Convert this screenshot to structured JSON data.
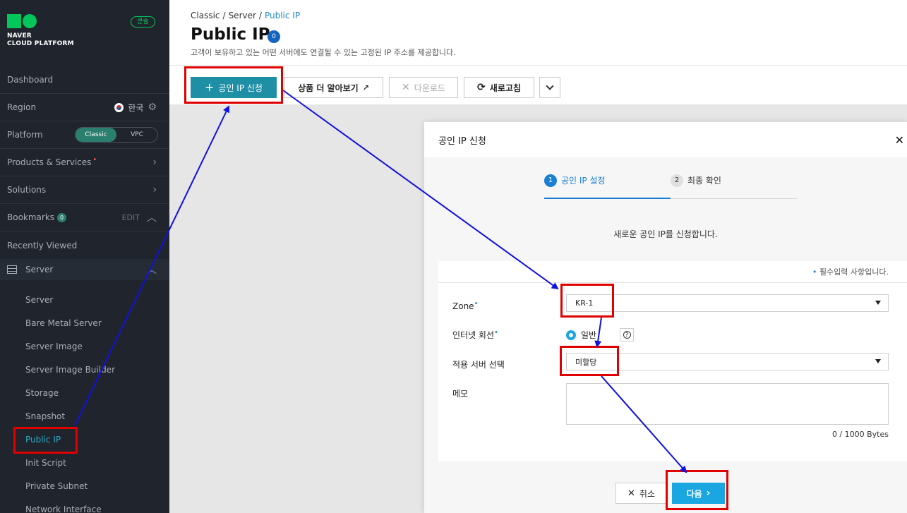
{
  "sidebar": {
    "logo_line1": "NAVER",
    "logo_line2": "CLOUD PLATFORM",
    "lang_badge": "쿤솔",
    "dashboard": "Dashboard",
    "region_label": "Region",
    "region_value": "한국",
    "platform_label": "Platform",
    "platform_classic": "Classic",
    "platform_vpc": "VPC",
    "products": "Products & Services",
    "products_marker": "•",
    "solutions": "Solutions",
    "bookmarks": "Bookmarks",
    "bookmarks_count": "0",
    "bookmarks_edit": "EDIT",
    "recently_viewed": "Recently Viewed",
    "server_group": "Server",
    "items": [
      "Server",
      "Bare Metal Server",
      "Server Image",
      "Server Image Builder",
      "Storage",
      "Snapshot",
      "Public IP",
      "Init Script",
      "Private Subnet",
      "Network Interface"
    ]
  },
  "breadcrumb": {
    "c1": "Classic",
    "sep": "/",
    "c2": "Server",
    "c3": "Public IP"
  },
  "page": {
    "title": "Public IP",
    "count": "0",
    "description": "고객이 보유하고 있는 어떤 서버에도 연결될 수 있는 고정된 IP 주소를 제공합니다."
  },
  "toolbar": {
    "apply": "공인 IP 신청",
    "learn_more": "상품 더 알아보기",
    "download": "다운로드",
    "refresh": "새로고침"
  },
  "modal": {
    "title": "공인 IP 신청",
    "step1_num": "1",
    "step1": "공인 IP 설정",
    "step2_num": "2",
    "step2": "최종 확인",
    "intro": "새로운 공인 IP를 신청합니다.",
    "required_note": "필수입력 사항입니다.",
    "zone_label": "Zone",
    "zone_value": "KR-1",
    "line_label": "인터넷 회선",
    "line_value": "일반",
    "server_label": "적용 서버 선택",
    "server_value": "미할당",
    "memo_label": "메모",
    "bytes": "0 / 1000 Bytes",
    "cancel": "취소",
    "next": "다음"
  },
  "colors": {
    "sidebar_bg": "#20252d",
    "accent_teal": "#1f8fa6",
    "active_link": "#27a8c8",
    "step_blue": "#1a7fd4",
    "next_blue": "#1aa6e0",
    "highlight_red": "#e00000",
    "arrow_blue": "#1010e0"
  }
}
